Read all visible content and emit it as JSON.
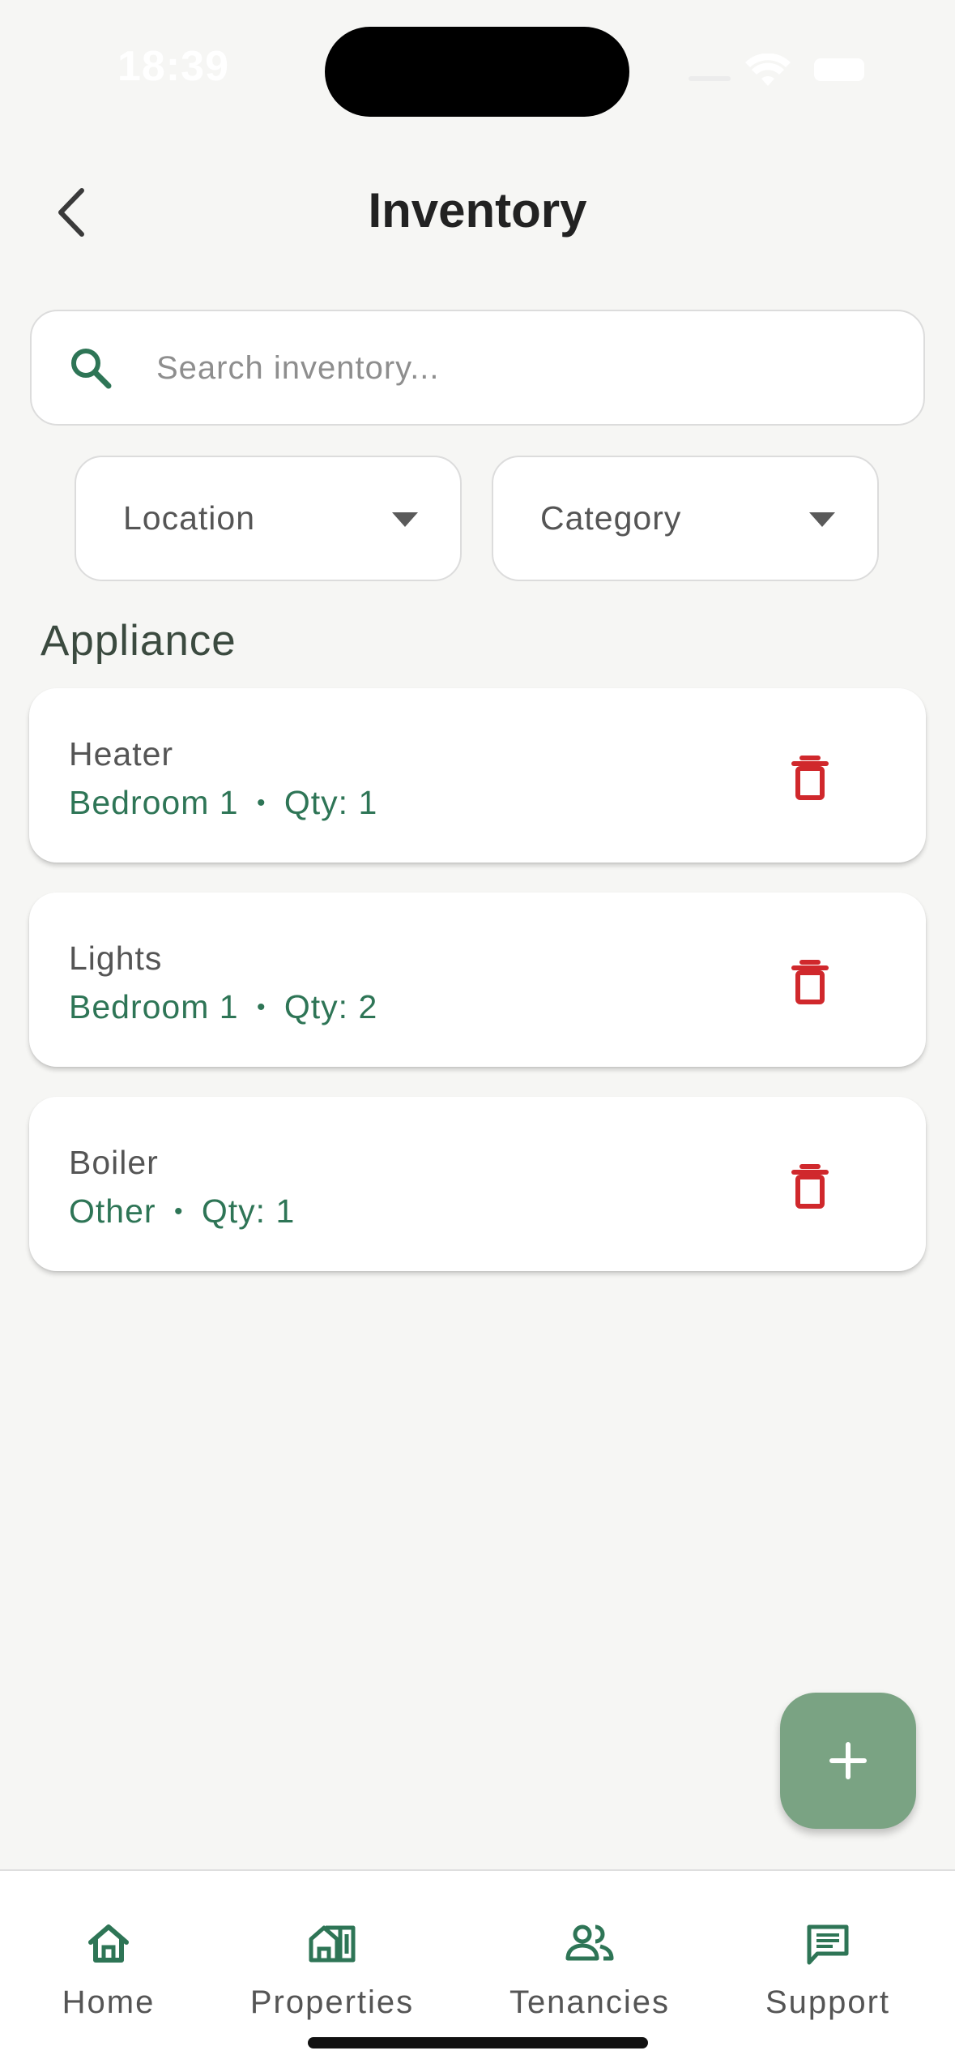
{
  "status_bar": {
    "time": "18:39"
  },
  "header": {
    "title": "Inventory"
  },
  "search": {
    "placeholder": "Search inventory..."
  },
  "filters": {
    "location_label": "Location",
    "category_label": "Category"
  },
  "section": {
    "title": "Appliance"
  },
  "items": [
    {
      "name": "Heater",
      "location": "Bedroom 1",
      "separator": "•",
      "qty_label": "Qty: 1"
    },
    {
      "name": "Lights",
      "location": "Bedroom 1",
      "separator": "•",
      "qty_label": "Qty: 2"
    },
    {
      "name": "Boiler",
      "location": "Other",
      "separator": "•",
      "qty_label": "Qty: 1"
    }
  ],
  "nav": {
    "items": [
      {
        "label": "Home",
        "icon": "home-icon"
      },
      {
        "label": "Properties",
        "icon": "properties-icon"
      },
      {
        "label": "Tenancies",
        "icon": "people-icon"
      },
      {
        "label": "Support",
        "icon": "chat-icon"
      }
    ]
  },
  "colors": {
    "accent_green": "#2e7556",
    "fab_green": "#7aa383",
    "delete_red": "#d0282c",
    "background": "#f6f6f4"
  }
}
